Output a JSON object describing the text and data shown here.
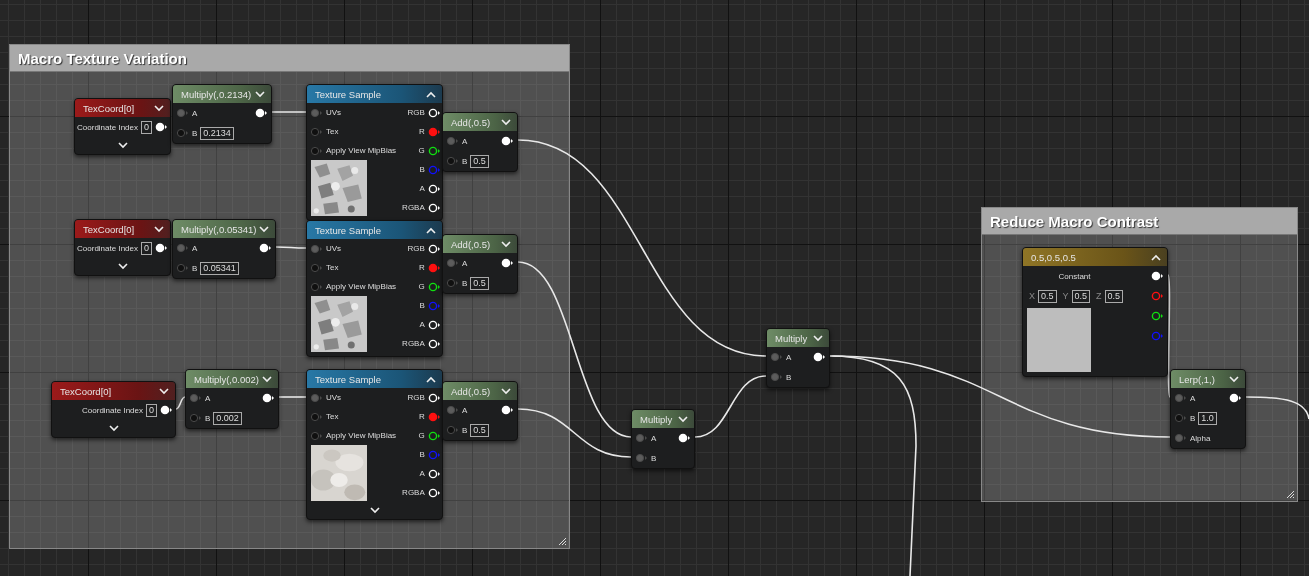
{
  "comments": [
    {
      "title": "Macro Texture Variation"
    },
    {
      "title": "Reduce Macro Contrast"
    }
  ],
  "nodes": [
    {
      "kind": "texcoord",
      "title": "TexCoord[0]",
      "expanded": false,
      "label": "Coordinate Index",
      "value": "0"
    },
    {
      "kind": "op",
      "title": "Multiply(,0.2134)",
      "expanded": false,
      "inputs": [
        {
          "label": "A",
          "connected": true
        },
        {
          "label": "B",
          "connected": false,
          "value": "0.2134"
        }
      ]
    },
    {
      "kind": "texture",
      "title": "Texture Sample",
      "expanded": true,
      "show_expander": false,
      "inputs": [
        {
          "label": "UVs",
          "connected": true
        },
        {
          "label": "Tex",
          "connected": false
        },
        {
          "label": "Apply View MipBias",
          "connected": false
        }
      ],
      "outputs": [
        {
          "label": "RGB",
          "color": "#ffffff",
          "connected": false
        },
        {
          "label": "R",
          "color": "#ff1010",
          "connected": true
        },
        {
          "label": "G",
          "color": "#10e010",
          "connected": false
        },
        {
          "label": "B",
          "color": "#1010ff",
          "connected": false
        },
        {
          "label": "A",
          "color": "#ffffff",
          "connected": false
        },
        {
          "label": "RGBA",
          "color": "#ffffff",
          "connected": false
        }
      ]
    },
    {
      "kind": "op",
      "title": "Add(,0.5)",
      "expanded": false,
      "inputs": [
        {
          "label": "A",
          "connected": true
        },
        {
          "label": "B",
          "connected": false,
          "value": "0.5"
        }
      ]
    },
    {
      "kind": "texcoord",
      "title": "TexCoord[0]",
      "expanded": false,
      "label": "Coordinate Index",
      "value": "0"
    },
    {
      "kind": "op",
      "title": "Multiply(,0.05341)",
      "expanded": false,
      "inputs": [
        {
          "label": "A",
          "connected": true
        },
        {
          "label": "B",
          "connected": false,
          "value": "0.05341"
        }
      ]
    },
    {
      "kind": "texture",
      "title": "Texture Sample",
      "expanded": true,
      "show_expander": false,
      "inputs": [
        {
          "label": "UVs",
          "connected": true
        },
        {
          "label": "Tex",
          "connected": false
        },
        {
          "label": "Apply View MipBias",
          "connected": false
        }
      ],
      "outputs": [
        {
          "label": "RGB",
          "color": "#ffffff",
          "connected": false
        },
        {
          "label": "R",
          "color": "#ff1010",
          "connected": true
        },
        {
          "label": "G",
          "color": "#10e010",
          "connected": false
        },
        {
          "label": "B",
          "color": "#1010ff",
          "connected": false
        },
        {
          "label": "A",
          "color": "#ffffff",
          "connected": false
        },
        {
          "label": "RGBA",
          "color": "#ffffff",
          "connected": false
        }
      ]
    },
    {
      "kind": "op",
      "title": "Add(,0.5)",
      "expanded": false,
      "inputs": [
        {
          "label": "A",
          "connected": true
        },
        {
          "label": "B",
          "connected": false,
          "value": "0.5"
        }
      ]
    },
    {
      "kind": "texcoord",
      "title": "TexCoord[0]",
      "expanded": false,
      "label": "Coordinate Index",
      "value": "0"
    },
    {
      "kind": "op",
      "title": "Multiply(,0.002)",
      "expanded": false,
      "inputs": [
        {
          "label": "A",
          "connected": true
        },
        {
          "label": "B",
          "connected": false,
          "value": "0.002"
        }
      ]
    },
    {
      "kind": "texture",
      "title": "Texture Sample",
      "expanded": true,
      "show_expander": true,
      "inputs": [
        {
          "label": "UVs",
          "connected": true
        },
        {
          "label": "Tex",
          "connected": false
        },
        {
          "label": "Apply View MipBias",
          "connected": false
        }
      ],
      "outputs": [
        {
          "label": "RGB",
          "color": "#ffffff",
          "connected": false
        },
        {
          "label": "R",
          "color": "#ff1010",
          "connected": true
        },
        {
          "label": "G",
          "color": "#10e010",
          "connected": false
        },
        {
          "label": "B",
          "color": "#1010ff",
          "connected": false
        },
        {
          "label": "A",
          "color": "#ffffff",
          "connected": false
        },
        {
          "label": "RGBA",
          "color": "#ffffff",
          "connected": false
        }
      ]
    },
    {
      "kind": "op",
      "title": "Add(,0.5)",
      "expanded": false,
      "inputs": [
        {
          "label": "A",
          "connected": true
        },
        {
          "label": "B",
          "connected": false,
          "value": "0.5"
        }
      ]
    },
    {
      "kind": "op",
      "title": "Multiply",
      "expanded": false,
      "inputs": [
        {
          "label": "A",
          "connected": true
        },
        {
          "label": "B",
          "connected": true
        }
      ]
    },
    {
      "kind": "op",
      "title": "Multiply",
      "expanded": false,
      "inputs": [
        {
          "label": "A",
          "connected": true
        },
        {
          "label": "B",
          "connected": true
        }
      ]
    },
    {
      "kind": "constant",
      "title": "0.5,0.5,0.5",
      "expanded": true,
      "label": "Constant",
      "fields": [
        {
          "axis": "X",
          "value": "0.5"
        },
        {
          "axis": "Y",
          "value": "0.5"
        },
        {
          "axis": "Z",
          "value": "0.5"
        }
      ],
      "outputs": [
        {
          "color": "#ffffff",
          "connected": true
        },
        {
          "color": "#ff1010",
          "connected": false
        },
        {
          "color": "#10e010",
          "connected": false
        },
        {
          "color": "#1010ff",
          "connected": false
        }
      ]
    },
    {
      "kind": "op",
      "title": "Lerp(,1,)",
      "expanded": false,
      "inputs": [
        {
          "label": "A",
          "connected": true
        },
        {
          "label": "B",
          "connected": false,
          "value": "1.0"
        },
        {
          "label": "Alpha",
          "connected": true
        }
      ]
    }
  ],
  "wires": {
    "kind": "drawing"
  }
}
